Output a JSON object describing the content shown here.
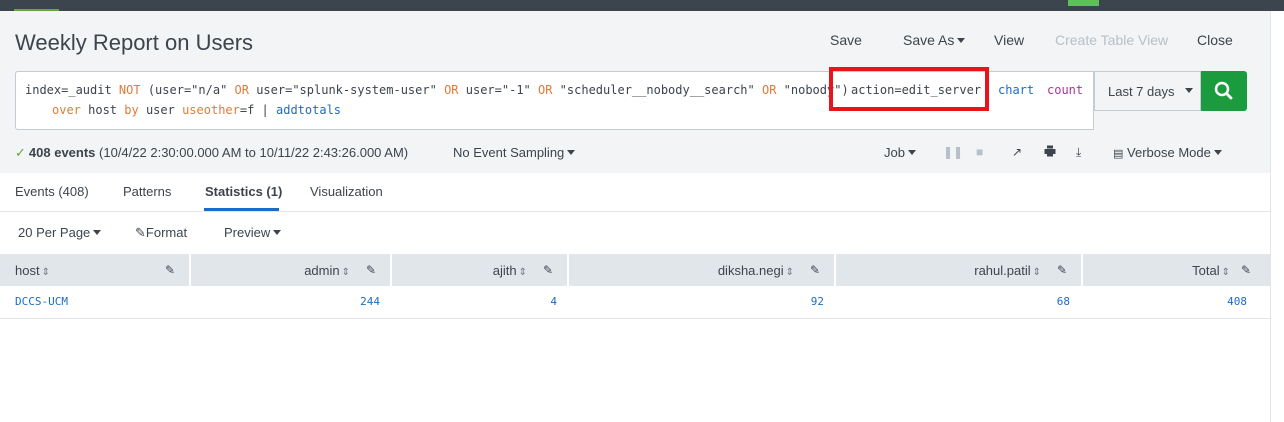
{
  "header": {
    "title": "Weekly Report on Users",
    "actions": {
      "save": "Save",
      "save_as": "Save As",
      "view": "View",
      "create_table_view": "Create Table View",
      "close": "Close"
    }
  },
  "search": {
    "line1": {
      "t1": "index=_audit ",
      "t2": "NOT",
      "t3": " (user=\"n/a\" ",
      "t4": "OR",
      "t5": " user=\"splunk-system-user\" ",
      "t6": "OR",
      "t7": " user=\"-1\" ",
      "t8": "OR",
      "t9": " \"scheduler__nobody__search\" ",
      "t10": "OR",
      "t11": " \"nobody\")",
      "highlighted": "action=edit_server",
      "chart": "chart",
      "count": "count"
    },
    "line2": {
      "over": "over",
      "t1": " host ",
      "by": "by",
      "t2": " user ",
      "useother": "useother",
      "t3": "=f | ",
      "addtotals": "addtotals"
    },
    "time_range": "Last 7 days"
  },
  "status": {
    "event_count": "408 events",
    "range": "(10/4/22 2:30:00.000 AM to 10/11/22 2:43:26.000 AM)",
    "sampling": "No Event Sampling",
    "job": "Job",
    "mode": "Verbose Mode"
  },
  "tabs": [
    "Events (408)",
    "Patterns",
    "Statistics (1)",
    "Visualization"
  ],
  "toolbar": {
    "per_page": "20 Per Page",
    "format": "Format",
    "preview": "Preview"
  },
  "table": {
    "columns": [
      "host",
      "admin",
      "ajith",
      "diksha.negi",
      "rahul.patil",
      "Total"
    ],
    "rows": [
      [
        "DCCS-UCM",
        "244",
        "4",
        "92",
        "68",
        "408"
      ]
    ]
  },
  "colors": {
    "highlight": "#e8141d",
    "search_button": "#1a9c3e",
    "link": "#1a6cc8",
    "keyword": "#e07b39",
    "command_arg": "#a3399c"
  }
}
